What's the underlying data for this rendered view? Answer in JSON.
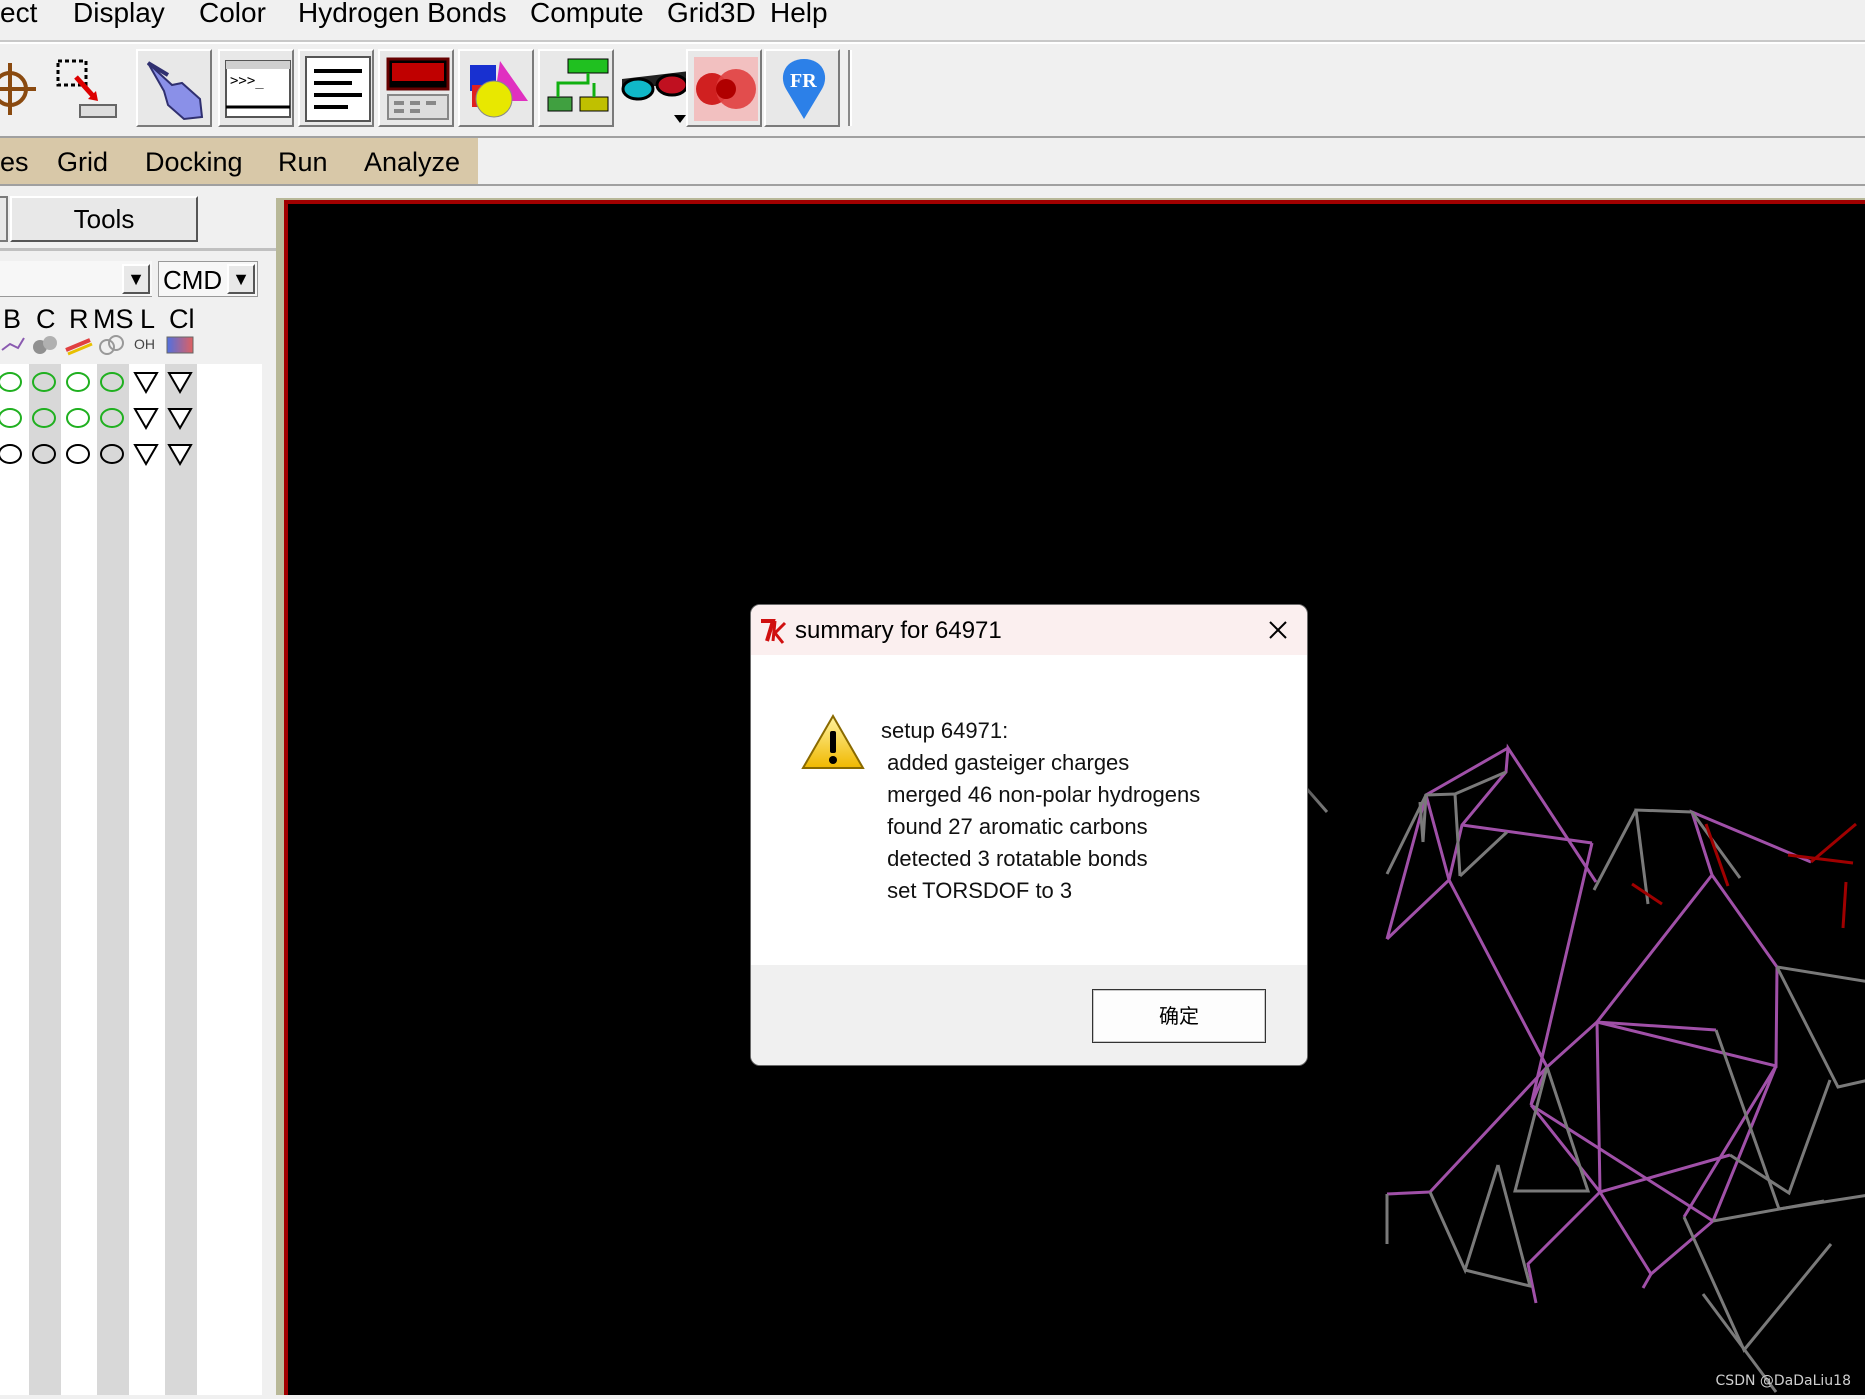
{
  "menubar": {
    "items": [
      "ect",
      "Display",
      "Color",
      "Hydrogen Bonds",
      "Compute",
      "Grid3D",
      "Help"
    ]
  },
  "toolbar": {
    "buttons": [
      "crosshair-target-icon",
      "select-to-delete-icon",
      "pointing-hand-icon",
      "python-shell-icon",
      "text-lines-icon",
      "dashboard-panel-icon",
      "geometric-shapes-icon",
      "network-flow-icon",
      "stereo-glasses-icon",
      "red-spheres-icon",
      "fr-logo-icon"
    ]
  },
  "menubar2": {
    "items": [
      "es",
      "Grid",
      "Docking",
      "Run",
      "Analyze"
    ],
    "accent": "#d8c8a8"
  },
  "left_panel": {
    "tools_button": "Tools",
    "combo_value": "CMD",
    "columns": [
      "B",
      "C",
      "R",
      "MS",
      "L",
      "Cl"
    ],
    "l_sub_label": "OH",
    "rows": [
      {
        "ovals": [
          "green",
          "green",
          "green",
          "green"
        ],
        "triangles": 2
      },
      {
        "ovals": [
          "green",
          "green",
          "green",
          "green"
        ],
        "triangles": 2
      },
      {
        "ovals": [
          "black",
          "black",
          "black",
          "black"
        ],
        "triangles": 2
      }
    ]
  },
  "viewer": {
    "background": "#000000",
    "border_color": "#a00000",
    "watermark": "CSDN @DaDaLiu18"
  },
  "dialog": {
    "title": "summary for 64971",
    "icon": "warning-icon",
    "lines": [
      "setup 64971:",
      " added gasteiger charges",
      " merged 46 non-polar hydrogens",
      " found 27 aromatic carbons",
      " detected 3 rotatable bonds",
      " set TORSDOF to 3"
    ],
    "ok_label": "确定"
  }
}
